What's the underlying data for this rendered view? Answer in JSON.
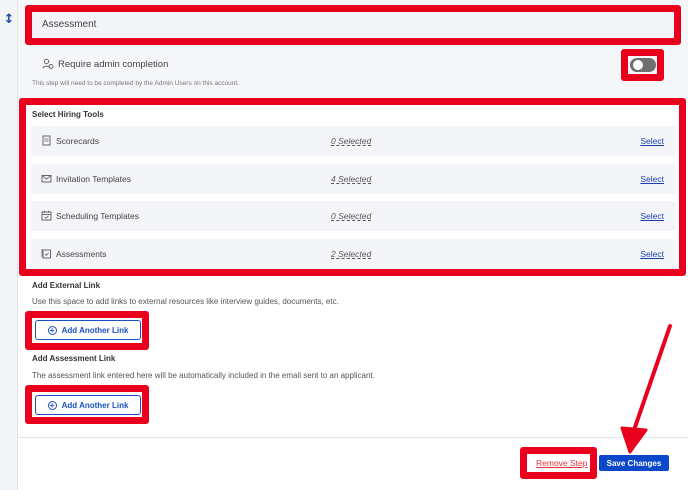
{
  "step": {
    "name_value": "Assessment",
    "require_admin": {
      "label": "Require admin completion",
      "help": "This step will need to be completed by the Admin Users on this account.",
      "enabled": false
    }
  },
  "hiring_tools": {
    "title": "Select Hiring Tools",
    "items": [
      {
        "label": "Scorecards",
        "count": "0 Selected",
        "action": "Select",
        "icon": "document-icon"
      },
      {
        "label": "Invitation Templates",
        "count": "4 Selected",
        "action": "Select",
        "icon": "envelope-icon"
      },
      {
        "label": "Scheduling Templates",
        "count": "0 Selected",
        "action": "Select",
        "icon": "calendar-icon"
      },
      {
        "label": "Assessments",
        "count": "2 Selected",
        "action": "Select",
        "icon": "assessment-icon"
      }
    ]
  },
  "external_link": {
    "title": "Add External Link",
    "description": "Use this space to add links to external resources like interview guides, documents, etc.",
    "button_label": "Add Another Link"
  },
  "assessment_link": {
    "title": "Add Assessment Link",
    "description": "The assessment link entered here will be automatically included in the email sent to an applicant.",
    "button_label": "Add Another Link"
  },
  "footer": {
    "remove_label": "Remove Step",
    "save_label": "Save Changes"
  },
  "colors": {
    "highlight": "#e8001c",
    "accent": "#0b48c9",
    "danger_link": "#e8303a"
  }
}
